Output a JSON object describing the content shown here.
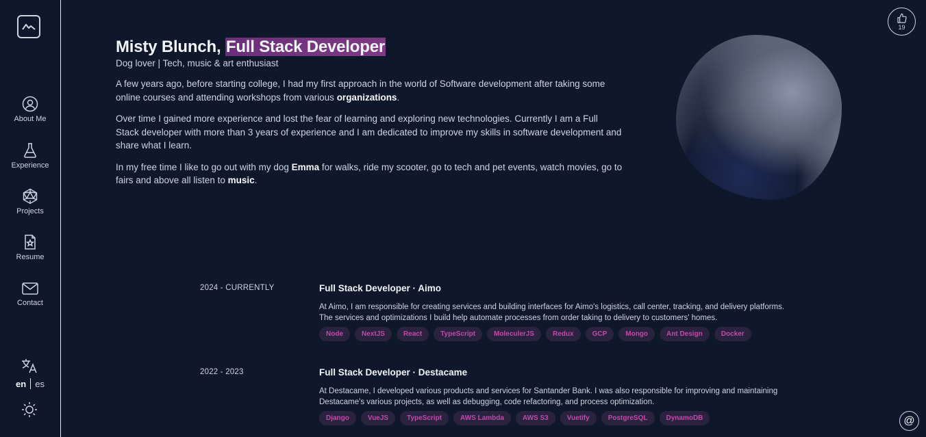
{
  "sidebar": {
    "items": [
      {
        "label": "About Me",
        "icon": "user-circle-icon"
      },
      {
        "label": "Experience",
        "icon": "flask-icon"
      },
      {
        "label": "Projects",
        "icon": "polyhedron-icon"
      },
      {
        "label": "Resume",
        "icon": "file-star-icon"
      },
      {
        "label": "Contact",
        "icon": "mail-icon"
      }
    ],
    "lang_active": "en",
    "lang_other": "es"
  },
  "likes": {
    "count": "19"
  },
  "contact_button": "@",
  "hero": {
    "name": "Misty Blunch,",
    "role": "Full Stack Developer",
    "subtitle": "Dog lover | Tech, music & art enthusiast",
    "p1_a": "A few years ago, before starting college, I had my first approach in the world of Software development after taking some online courses and attending workshops from various ",
    "p1_b": "organizations",
    "p1_c": ".",
    "p2": "Over time I gained more experience and lost the fear of learning and exploring new technologies. Currently I am a Full Stack developer with more than 3 years of experience and I am dedicated to improve my skills in software development and share what I learn.",
    "p3_a": "In my free time I like to go out with my dog ",
    "p3_b": "Emma",
    "p3_c": " for walks, ride my scooter, go to tech and pet events, watch movies, go to fairs and above all listen to ",
    "p3_d": "music",
    "p3_e": "."
  },
  "experience": [
    {
      "date": "2024 - CURRENTLY",
      "title": "Full Stack Developer · Aimo",
      "desc": "At Aimo, I am responsible for creating services and building interfaces for Aimo's logistics, call center, tracking, and delivery platforms. The services and optimizations I build help automate processes from order taking to delivery to customers' homes.",
      "tags": [
        "Node",
        "NextJS",
        "React",
        "TypeScript",
        "MoleculerJS",
        "Redux",
        "GCP",
        "Mongo",
        "Ant Design",
        "Docker"
      ]
    },
    {
      "date": "2022 - 2023",
      "title": "Full Stack Developer · Destacame",
      "desc": "At Destacame, I developed various products and services for Santander Bank. I was also responsible for improving and maintaining Destacame's various projects, as well as debugging, code refactoring, and process optimization.",
      "tags": [
        "Django",
        "VueJS",
        "TypeScript",
        "AWS Lambda",
        "AWS S3",
        "Vuetify",
        "PostgreSQL",
        "DynamoDB"
      ]
    }
  ]
}
